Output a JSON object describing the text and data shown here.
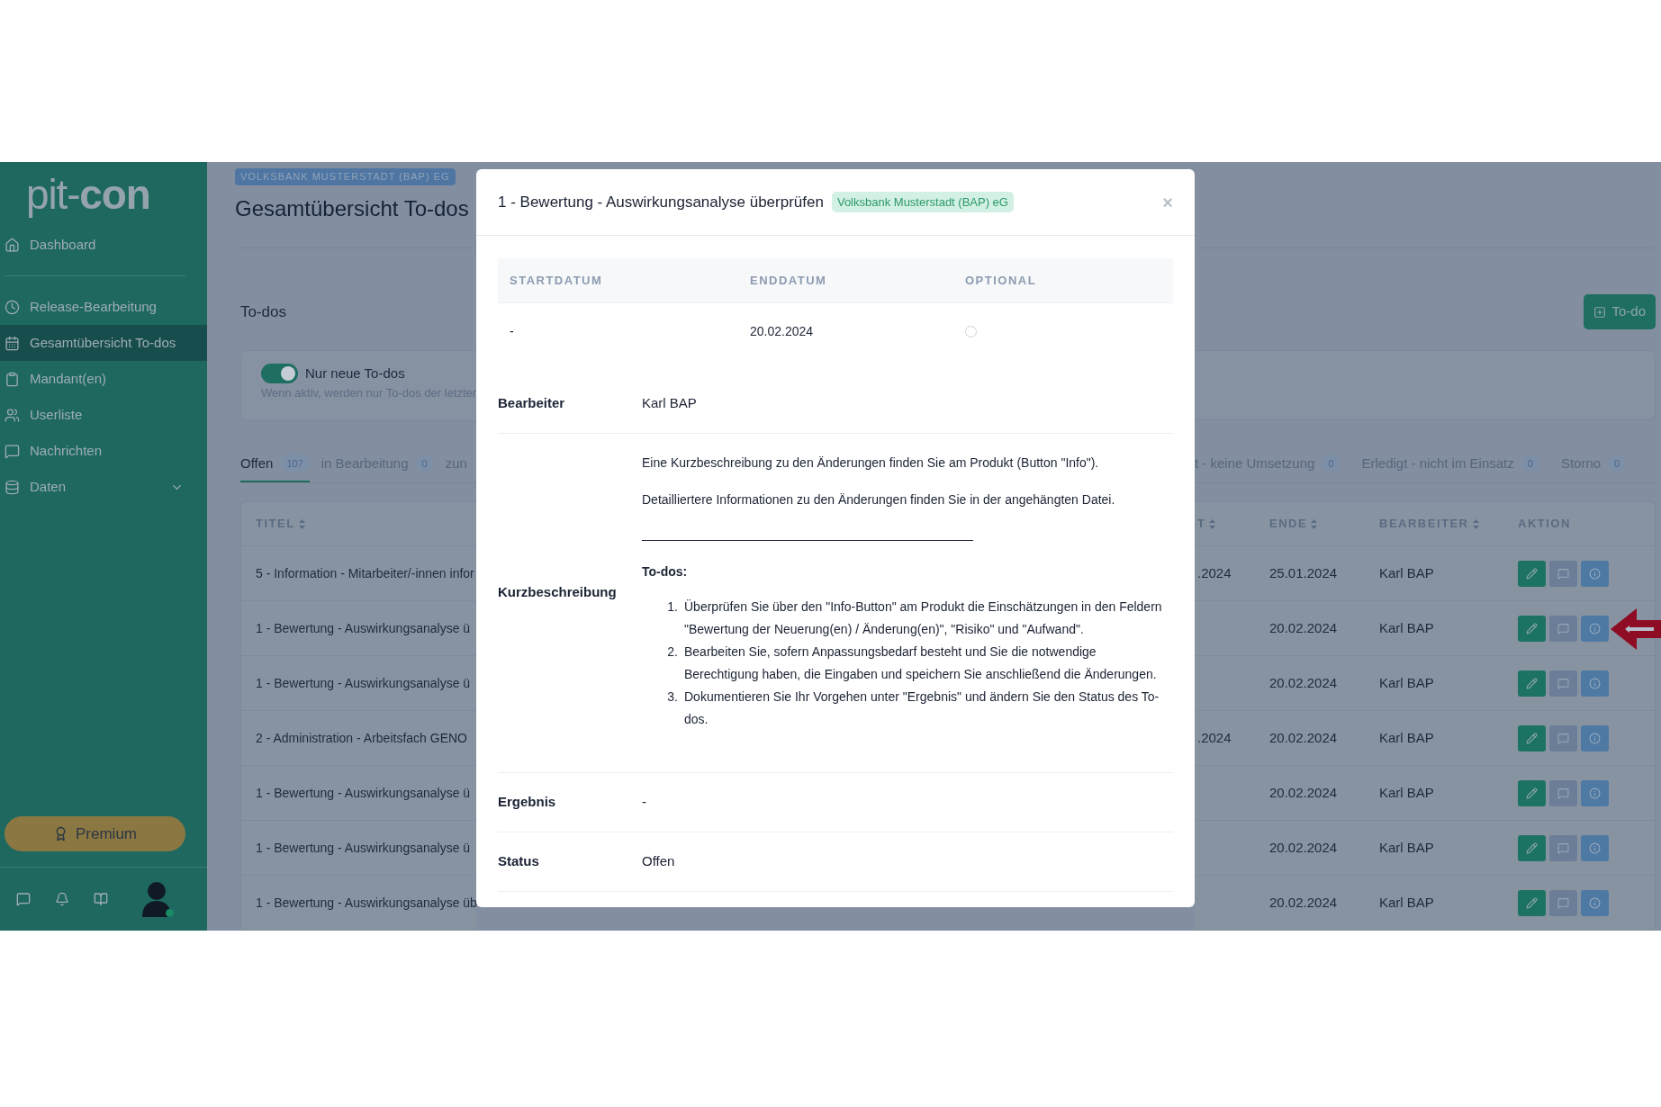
{
  "sidebar": {
    "logo_light": "pit-",
    "logo_bold": "con",
    "items": [
      {
        "label": "Dashboard",
        "selected": false,
        "expandable": false
      },
      {
        "label": "Release-Bearbeitung",
        "selected": false,
        "expandable": false
      },
      {
        "label": "Gesamtübersicht To-dos",
        "selected": true,
        "expandable": false
      },
      {
        "label": "Mandant(en)",
        "selected": false,
        "expandable": false
      },
      {
        "label": "Userliste",
        "selected": false,
        "expandable": false
      },
      {
        "label": "Nachrichten",
        "selected": false,
        "expandable": false
      },
      {
        "label": "Daten",
        "selected": false,
        "expandable": true
      }
    ],
    "premium_button": "Premium",
    "avatar_online": true
  },
  "header": {
    "org_badge": "VOLKSBANK MUSTERSTADT (BAP) EG",
    "title": "Gesamtübersicht To-dos"
  },
  "section_title": "To-dos",
  "add_button": "To-do",
  "filter": {
    "toggle_label": "Nur neue To-dos",
    "on": true,
    "hint": "Wenn aktiv, werden nur To-dos der letzter"
  },
  "tabs_left": [
    {
      "label": "Offen",
      "count": "107",
      "selected": true
    },
    {
      "label": "in Bearbeitung",
      "count": "0",
      "selected": false
    },
    {
      "label": "zun",
      "selected": false
    }
  ],
  "tabs_right": [
    {
      "label": "t - keine Umsetzung",
      "count": "0",
      "selected": false
    },
    {
      "label": "Erledigt - nicht im Einsatz",
      "count": "0",
      "selected": false
    },
    {
      "label": "Storno",
      "count": "0",
      "selected": false
    }
  ],
  "table": {
    "columns_left": [
      {
        "label": "TITEL",
        "sortable": true
      }
    ],
    "columns_right": [
      {
        "label": "T",
        "sortable": true
      },
      {
        "label": "ENDE",
        "sortable": true
      },
      {
        "label": "BEARBEITER",
        "sortable": true
      },
      {
        "label": "AKTION",
        "sortable": false
      }
    ],
    "rows": [
      {
        "title": "5 - Information - Mitarbeiter/-innen infor",
        "start": ".2024",
        "end": "25.01.2024",
        "assignee": "Karl BAP",
        "marked": false
      },
      {
        "title": "1 - Bewertung - Auswirkungsanalyse ü",
        "end": "20.02.2024",
        "assignee": "Karl BAP",
        "marked": true
      },
      {
        "title": "1 - Bewertung - Auswirkungsanalyse ü",
        "end": "20.02.2024",
        "assignee": "Karl BAP",
        "marked": false
      },
      {
        "title": "2 - Administration - Arbeitsfach GENO",
        "start": ".2024",
        "end": "20.02.2024",
        "assignee": "Karl BAP",
        "marked": false
      },
      {
        "title": "1 - Bewertung - Auswirkungsanalyse ü",
        "end": "20.02.2024",
        "assignee": "Karl BAP",
        "marked": false
      },
      {
        "title": "1 - Bewertung - Auswirkungsanalyse ü",
        "end": "20.02.2024",
        "assignee": "Karl BAP",
        "marked": false
      },
      {
        "title": "1 - Bewertung - Auswirkungsanalyse üb",
        "end": "20.02.2024",
        "assignee": "Karl BAP",
        "marked": false
      }
    ]
  },
  "modal": {
    "title": "1 - Bewertung - Auswirkungsanalyse überprüfen",
    "badge": "Volksbank Musterstadt (BAP) eG",
    "close": "×",
    "dates": {
      "columns": [
        "STARTDATUM",
        "ENDDATUM",
        "OPTIONAL"
      ],
      "start": "-",
      "end": "20.02.2024",
      "optional": false
    },
    "fields": [
      {
        "label": "Bearbeiter",
        "kind": "text",
        "value": "Karl BAP"
      },
      {
        "label": "Kurzbeschreibung",
        "kind": "description",
        "paragraphs": [
          "Eine Kurzbeschreibung zu den Änderungen finden Sie am Produkt (Button \"Info\").",
          "Detailliertere Informationen zu den Änderungen finden Sie in der angehängten Datei."
        ],
        "todo_heading": "To-dos:",
        "steps": [
          {
            "number": "1.",
            "text": "Überprüfen Sie über den \"Info-Button\" am Produkt die Einschätzungen in den Feldern \"Bewertung der Neuerung(en) / Änderung(en)\", \"Risiko\" und \"Aufwand\"."
          },
          {
            "number": "2.",
            "text": "Bearbeiten Sie, sofern Anpassungsbedarf besteht und Sie die notwendige Berechtigung haben, die Eingaben und speichern Sie anschließend die Änderungen."
          },
          {
            "number": "3.",
            "text": "Dokumentieren Sie Ihr Vorgehen unter \"Ergebnis\" und ändern Sie den Status des To-dos."
          }
        ]
      },
      {
        "label": "Ergebnis",
        "kind": "text",
        "value": "-"
      },
      {
        "label": "Status",
        "kind": "text",
        "value": "Offen"
      }
    ]
  }
}
